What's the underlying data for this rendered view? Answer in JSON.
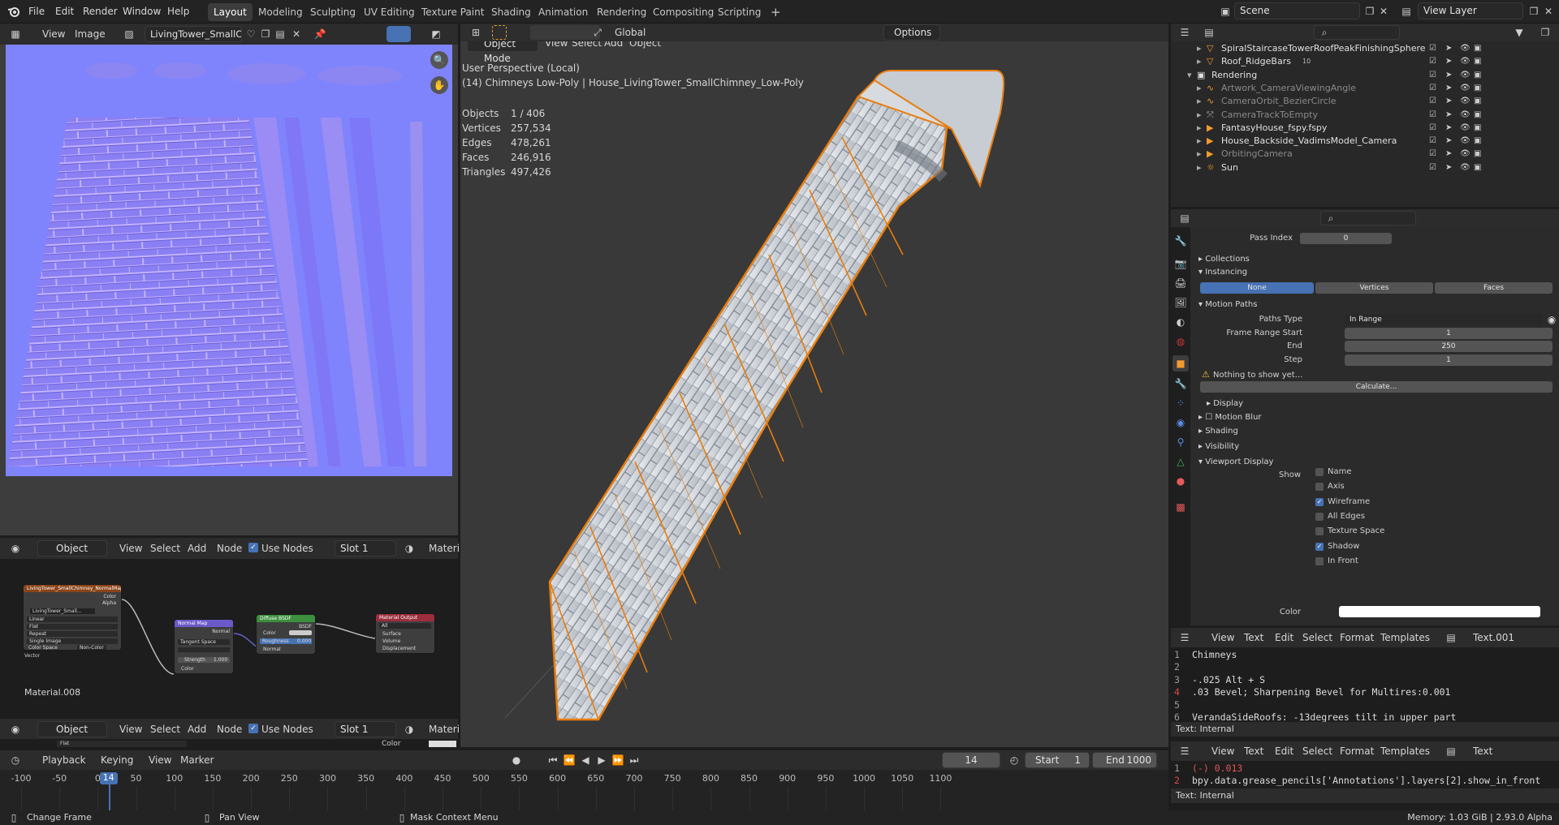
{
  "topbar": {
    "menus": [
      "File",
      "Edit",
      "Render",
      "Window",
      "Help"
    ],
    "workspaces": [
      "Layout",
      "Modeling",
      "Sculpting",
      "UV Editing",
      "Texture Paint",
      "Shading",
      "Animation",
      "Rendering",
      "Compositing",
      "Scripting"
    ],
    "active_workspace": "Layout",
    "plus": "+",
    "scene": "Scene",
    "view_layer": "View Layer"
  },
  "image_editor": {
    "view": "View",
    "image": "Image",
    "image_name": "LivingTower_SmallC..."
  },
  "node_editor": {
    "mode": "Object",
    "view": "View",
    "select": "Select",
    "add": "Add",
    "node": "Node",
    "use_nodes": "Use Nodes",
    "slot": "Slot 1",
    "material_short": "Materi",
    "material_name": "Material.008",
    "nodes": {
      "tex_title": "LivingTower_SmallChimney_NormalMap",
      "tex_img": "LivingTower_Small...",
      "tex_rows": [
        "Linear",
        "Flat",
        "Repeat",
        "Single Image",
        "Color Space"
      ],
      "tex_colorspace": "Non-Color",
      "tex_vector": "Vector",
      "tex_out_color": "Color",
      "tex_out_alpha": "Alpha",
      "nm_title": "Normal Map",
      "nm_normal": "Normal",
      "nm_space": "Tangent Space",
      "nm_strength": "Strength",
      "nm_strength_val": "1.000",
      "nm_color": "Color",
      "bsdf_title": "Diffuse BSDF",
      "bsdf_out": "BSDF",
      "bsdf_color": "Color",
      "bsdf_rough": "Roughness",
      "bsdf_rough_val": "0.000",
      "bsdf_normal": "Normal",
      "mo_title": "Material Output",
      "mo_all": "All",
      "mo_surface": "Surface",
      "mo_volume": "Volume",
      "mo_disp": "Displacement"
    }
  },
  "node_editor2": {
    "mode": "Object",
    "view": "View",
    "select": "Select",
    "add": "Add",
    "node": "Node",
    "use_nodes": "Use Nodes",
    "slot": "Slot 1",
    "material_short": "Materi",
    "row": "Flat",
    "color": "Color"
  },
  "viewport": {
    "mode": "Object Mode",
    "view": "View",
    "select": "Select",
    "add": "Add",
    "object": "Object",
    "orientation": "Global",
    "options": "Options",
    "perspective": "User Perspective (Local)",
    "active": "(14) Chimneys Low-Poly | House_LivingTower_SmallChimney_Low-Poly",
    "stats": [
      {
        "k": "Objects",
        "v": "1 / 406"
      },
      {
        "k": "Vertices",
        "v": "257,534"
      },
      {
        "k": "Edges",
        "v": "478,261"
      },
      {
        "k": "Faces",
        "v": "246,916"
      },
      {
        "k": "Triangles",
        "v": "497,426"
      }
    ]
  },
  "outliner": {
    "rows": [
      {
        "name": "SpiralStaircaseTowerRoofPeakFinishingSphere",
        "dim": false,
        "icon": "mesh"
      },
      {
        "name": "Roof_RidgeBars",
        "dim": false,
        "icon": "mesh",
        "badge": "10"
      },
      {
        "name": "Rendering",
        "dim": false,
        "icon": "collection"
      },
      {
        "name": "Artwork_CameraViewingAngle",
        "dim": true,
        "icon": "curve"
      },
      {
        "name": "CameraOrbit_BezierCircle",
        "dim": true,
        "icon": "curve"
      },
      {
        "name": "CameraTrackToEmpty",
        "dim": true,
        "icon": "empty"
      },
      {
        "name": "FantasyHouse_fspy.fspy",
        "dim": false,
        "icon": "camera"
      },
      {
        "name": "House_Backside_VadimsModel_Camera",
        "dim": false,
        "icon": "camera"
      },
      {
        "name": "OrbitingCamera",
        "dim": true,
        "icon": "camera"
      },
      {
        "name": "Sun",
        "dim": false,
        "icon": "light"
      }
    ]
  },
  "properties": {
    "pass_index_label": "Pass Index",
    "pass_index": "0",
    "collections": "Collections",
    "instancing": "Instancing",
    "inst_opts": [
      "None",
      "Vertices",
      "Faces"
    ],
    "motion_paths": "Motion Paths",
    "paths_type_label": "Paths Type",
    "paths_type": "In Range",
    "frs_label": "Frame Range Start",
    "frs": "1",
    "end_label": "End",
    "end": "250",
    "step_label": "Step",
    "step": "1",
    "nothing": "Nothing to show yet...",
    "calculate": "Calculate...",
    "display": "Display",
    "motion_blur": "Motion Blur",
    "shading": "Shading",
    "visibility": "Visibility",
    "viewport_display": "Viewport Display",
    "show": "Show",
    "show_items": [
      {
        "label": "Name",
        "checked": false
      },
      {
        "label": "Axis",
        "checked": false
      },
      {
        "label": "Wireframe",
        "checked": true
      },
      {
        "label": "All Edges",
        "checked": false
      },
      {
        "label": "Texture Space",
        "checked": false
      },
      {
        "label": "Shadow",
        "checked": true
      },
      {
        "label": "In Front",
        "checked": false
      }
    ],
    "color_label": "Color"
  },
  "text1": {
    "menus": [
      "View",
      "Text",
      "Edit",
      "Select",
      "Format",
      "Templates"
    ],
    "name": "Text.001",
    "footer": "Text: Internal",
    "lines": [
      "Chimneys",
      "",
      "-.025 Alt + S",
      ".03 Bevel; Sharpening Bevel for Multires:0.001",
      "",
      "VerandaSideRoofs: -13degrees tilt in upper part"
    ]
  },
  "text2": {
    "menus": [
      "View",
      "Text",
      "Edit",
      "Select",
      "Format",
      "Templates"
    ],
    "name": "Text",
    "footer": "Text: Internal",
    "lines": [
      "(-) 0.013",
      "bpy.data.grease_pencils['Annotations'].layers[2].show_in_front"
    ]
  },
  "timeline": {
    "playback": "Playback",
    "keying": "Keying",
    "view": "View",
    "marker": "Marker",
    "frame": "14",
    "start_label": "Start",
    "start": "1",
    "end_label": "End",
    "end": "1000",
    "ticks": [
      "-100",
      "-50",
      "0",
      "50",
      "100",
      "150",
      "200",
      "250",
      "300",
      "350",
      "400",
      "450",
      "500",
      "550",
      "600",
      "650",
      "700",
      "750",
      "800",
      "850",
      "900",
      "950",
      "1000",
      "1050",
      "1100"
    ]
  },
  "statusbar": {
    "change_frame": "Change Frame",
    "pan_view": "Pan View",
    "mask": "Mask Context Menu",
    "memory": "Memory: 1.03 GiB | 2.93.0 Alpha"
  },
  "colors": {
    "accent": "#4772b3",
    "selection": "#e87d0d",
    "normal_map": "#8080ff"
  }
}
